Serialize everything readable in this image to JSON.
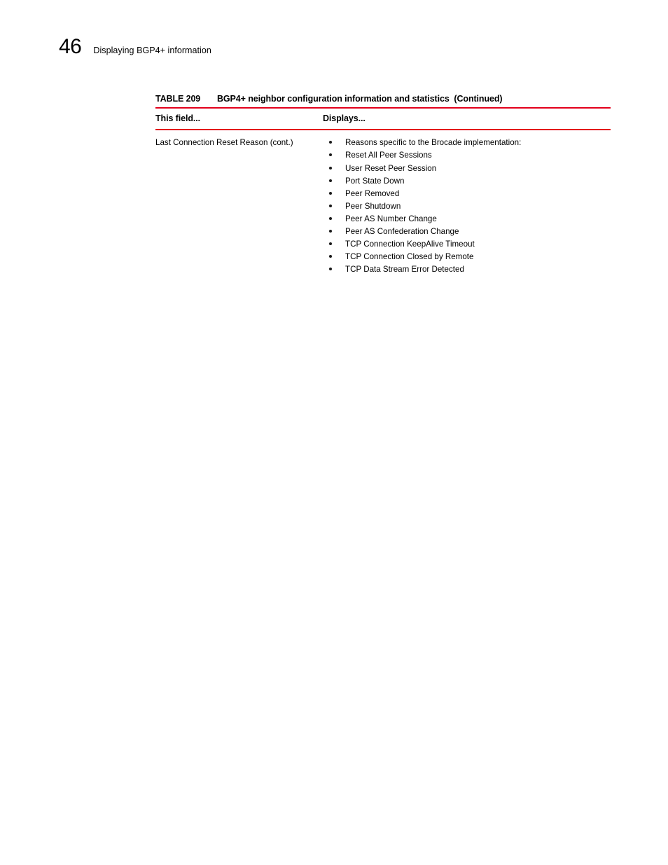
{
  "page": {
    "number": "46",
    "running_head": "Displaying BGP4+ information",
    "accent_color": "#E3001B"
  },
  "table": {
    "caption_label": "TABLE 209",
    "caption_title": "BGP4+ neighbor configuration information and statistics  (Continued)",
    "columns": [
      {
        "header": "This field..."
      },
      {
        "header": "Displays..."
      }
    ],
    "rows": [
      {
        "field": "Last Connection Reset Reason (cont.)",
        "displays": [
          "Reasons specific to the Brocade implementation:",
          "Reset All Peer Sessions",
          "User Reset Peer Session",
          "Port State Down",
          "Peer Removed",
          "Peer Shutdown",
          "Peer AS Number Change",
          "Peer AS Confederation Change",
          "TCP Connection KeepAlive Timeout",
          "TCP Connection Closed by Remote",
          "TCP Data Stream Error Detected"
        ]
      }
    ]
  }
}
